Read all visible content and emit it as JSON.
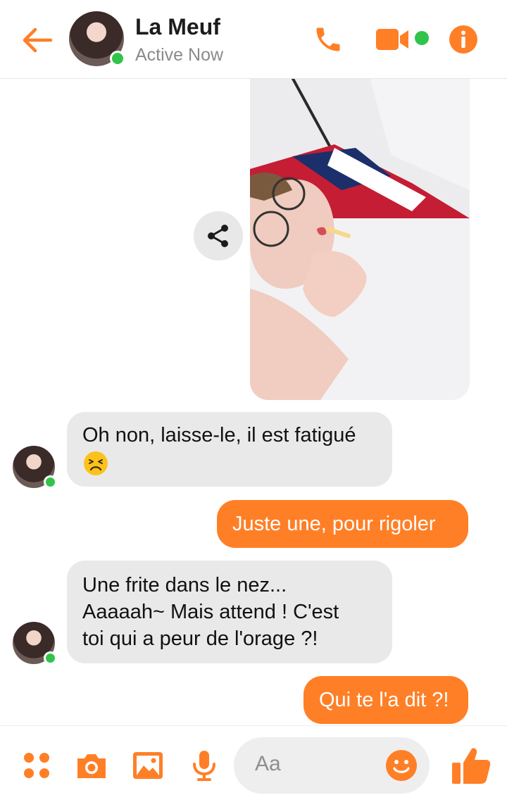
{
  "colors": {
    "accent": "#ff7f27",
    "online": "#31c44a",
    "incoming_bubble": "#e9e9e9"
  },
  "header": {
    "contact_name": "La Meuf",
    "status": "Active Now",
    "icons": [
      "back-arrow-icon",
      "phone-icon",
      "video-camera-icon",
      "info-icon"
    ]
  },
  "messages": [
    {
      "direction": "incoming",
      "lines": [
        "Oh non, laisse-le, il est fatigué"
      ],
      "emoji": "tired-face-emoji"
    },
    {
      "direction": "outgoing",
      "lines": [
        "Juste une, pour rigoler"
      ]
    },
    {
      "direction": "incoming",
      "lines": [
        "Une frite dans le nez...",
        "Aaaaah~ Mais attend ! C'est",
        "toi qui a peur de l'orage ?!"
      ]
    },
    {
      "direction": "outgoing",
      "lines": [
        "Qui te l'a dit ?!"
      ]
    }
  ],
  "composer": {
    "placeholder": "Aa",
    "icons": [
      "more-apps-icon",
      "camera-icon",
      "gallery-icon",
      "microphone-icon",
      "emoji-icon",
      "thumbs-up-icon"
    ]
  }
}
